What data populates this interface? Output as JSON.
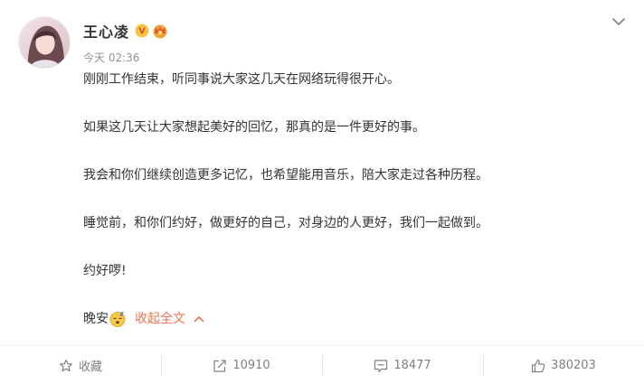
{
  "post": {
    "username": "王心凌",
    "timestamp": "今天 02:36",
    "paragraphs": [
      "刚刚工作结束，听同事说大家这几天在网络玩得很开心。",
      "如果这几天让大家想起美好的回忆，那真的是一件更好的事。",
      "我会和你们继续创造更多记忆，也希望能用音乐，陪大家走过各种历程。",
      "睡觉前，和你们约好，做更好的自己，对身边的人更好，我们一起做到。",
      "约好啰!"
    ],
    "last_line": "晚安",
    "last_line_emoji": "sleepy-face-emoji",
    "collapse_label": "收起全文"
  },
  "actions": {
    "favorite_label": "收藏",
    "repost_count": "10910",
    "comment_count": "18477",
    "like_count": "380203"
  },
  "colors": {
    "accent": "#eb7350",
    "text": "#333333",
    "muted": "#808080",
    "verified": "#f6c445"
  }
}
